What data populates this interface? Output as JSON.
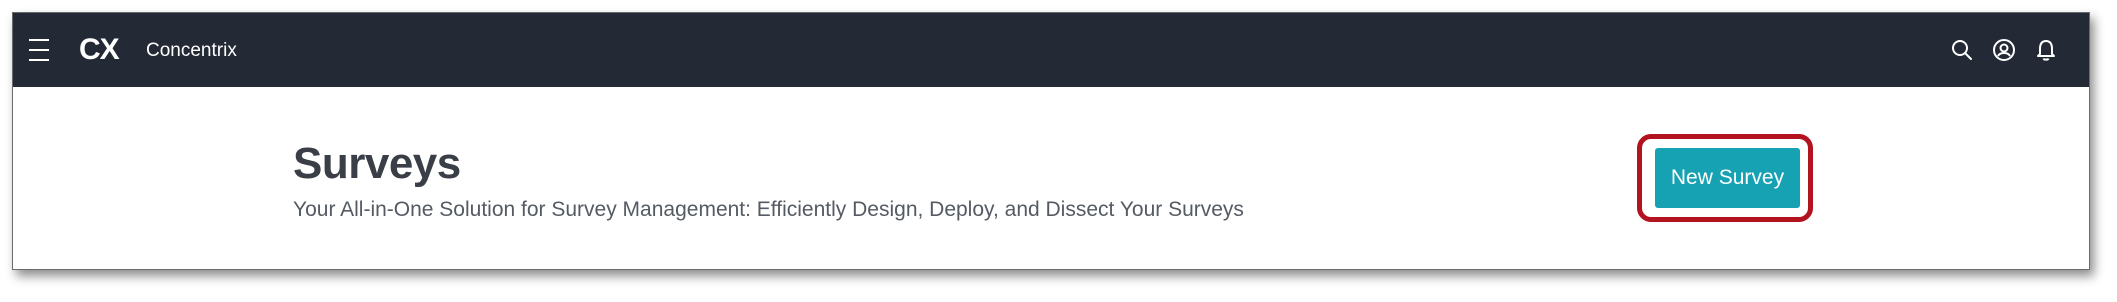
{
  "header": {
    "logo": "CX",
    "brand": "Concentrix",
    "icons": [
      "menu-icon",
      "search-icon",
      "account-icon",
      "notification-icon"
    ]
  },
  "page": {
    "title": "Surveys",
    "subtitle": "Your All-in-One Solution for Survey Management: Efficiently Design, Deploy, and Dissect Your Surveys",
    "new_survey_label": "New Survey"
  },
  "colors": {
    "topbar": "#232a35",
    "primary_button": "#17a2b3",
    "highlight_border": "#b3121f",
    "title_text": "#3a3f47"
  }
}
